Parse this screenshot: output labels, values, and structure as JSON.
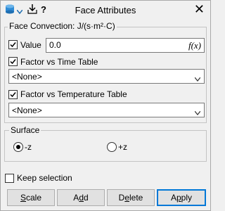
{
  "window": {
    "title": "Face Attributes",
    "close_glyph": "✕"
  },
  "toolbar": {
    "icons": [
      "object-selector-icon",
      "chevron-down-icon",
      "import-icon",
      "help-icon"
    ],
    "help_label": "?"
  },
  "convection": {
    "group_title": "Face Convection: J/(s·m²·C)",
    "value": {
      "label": "Value",
      "checked": true,
      "text": "0.0",
      "fx": "f(x)"
    },
    "time_table": {
      "label": "Factor vs Time Table",
      "checked": true,
      "selected": "<None>"
    },
    "temp_table": {
      "label": "Factor vs Temperature Table",
      "checked": true,
      "selected": "<None>"
    }
  },
  "surface": {
    "group_title": "Surface",
    "options": [
      {
        "label": "-z",
        "selected": true
      },
      {
        "label": "+z",
        "selected": false
      }
    ]
  },
  "keep_selection": {
    "label": "Keep selection",
    "checked": false
  },
  "buttons": {
    "scale": {
      "first": "S",
      "rest": "cale"
    },
    "add": {
      "pre": "A",
      "u": "d",
      "post": "d"
    },
    "delete": {
      "pre": "D",
      "u": "e",
      "post": "lete"
    },
    "apply": {
      "pre": "A",
      "u": "p",
      "post": "ply"
    }
  },
  "colors": {
    "accent": "#0078d7",
    "background": "#f0f0f0"
  }
}
